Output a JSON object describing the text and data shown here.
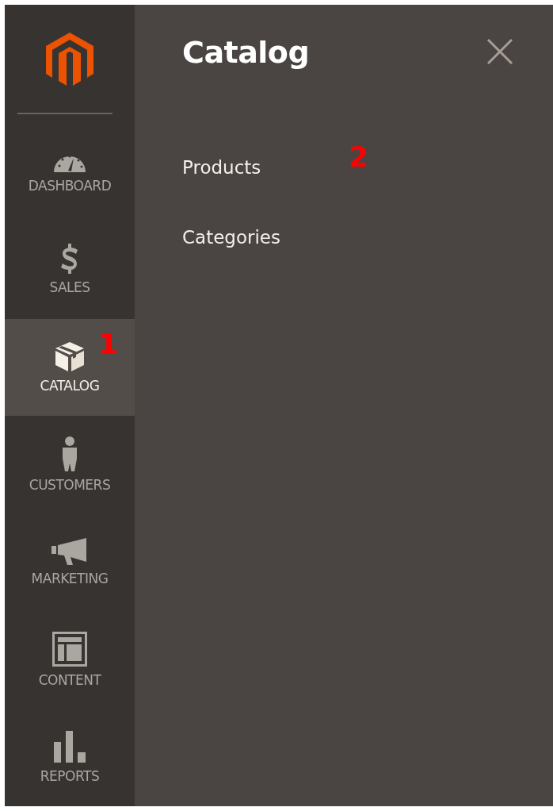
{
  "sidebar": {
    "items": [
      {
        "label": "DASHBOARD",
        "kind": "gauge",
        "selected": false
      },
      {
        "label": "SALES",
        "kind": "dollar",
        "selected": false
      },
      {
        "label": "CATALOG",
        "kind": "box",
        "selected": true,
        "annotation": "1"
      },
      {
        "label": "CUSTOMERS",
        "kind": "person",
        "selected": false
      },
      {
        "label": "MARKETING",
        "kind": "megaphone",
        "selected": false
      },
      {
        "label": "CONTENT",
        "kind": "layout",
        "selected": false
      },
      {
        "label": "REPORTS",
        "kind": "bars",
        "selected": false
      }
    ]
  },
  "panel": {
    "title": "Catalog",
    "items": [
      {
        "label": "Products",
        "annotation": "2"
      },
      {
        "label": "Categories"
      }
    ]
  }
}
